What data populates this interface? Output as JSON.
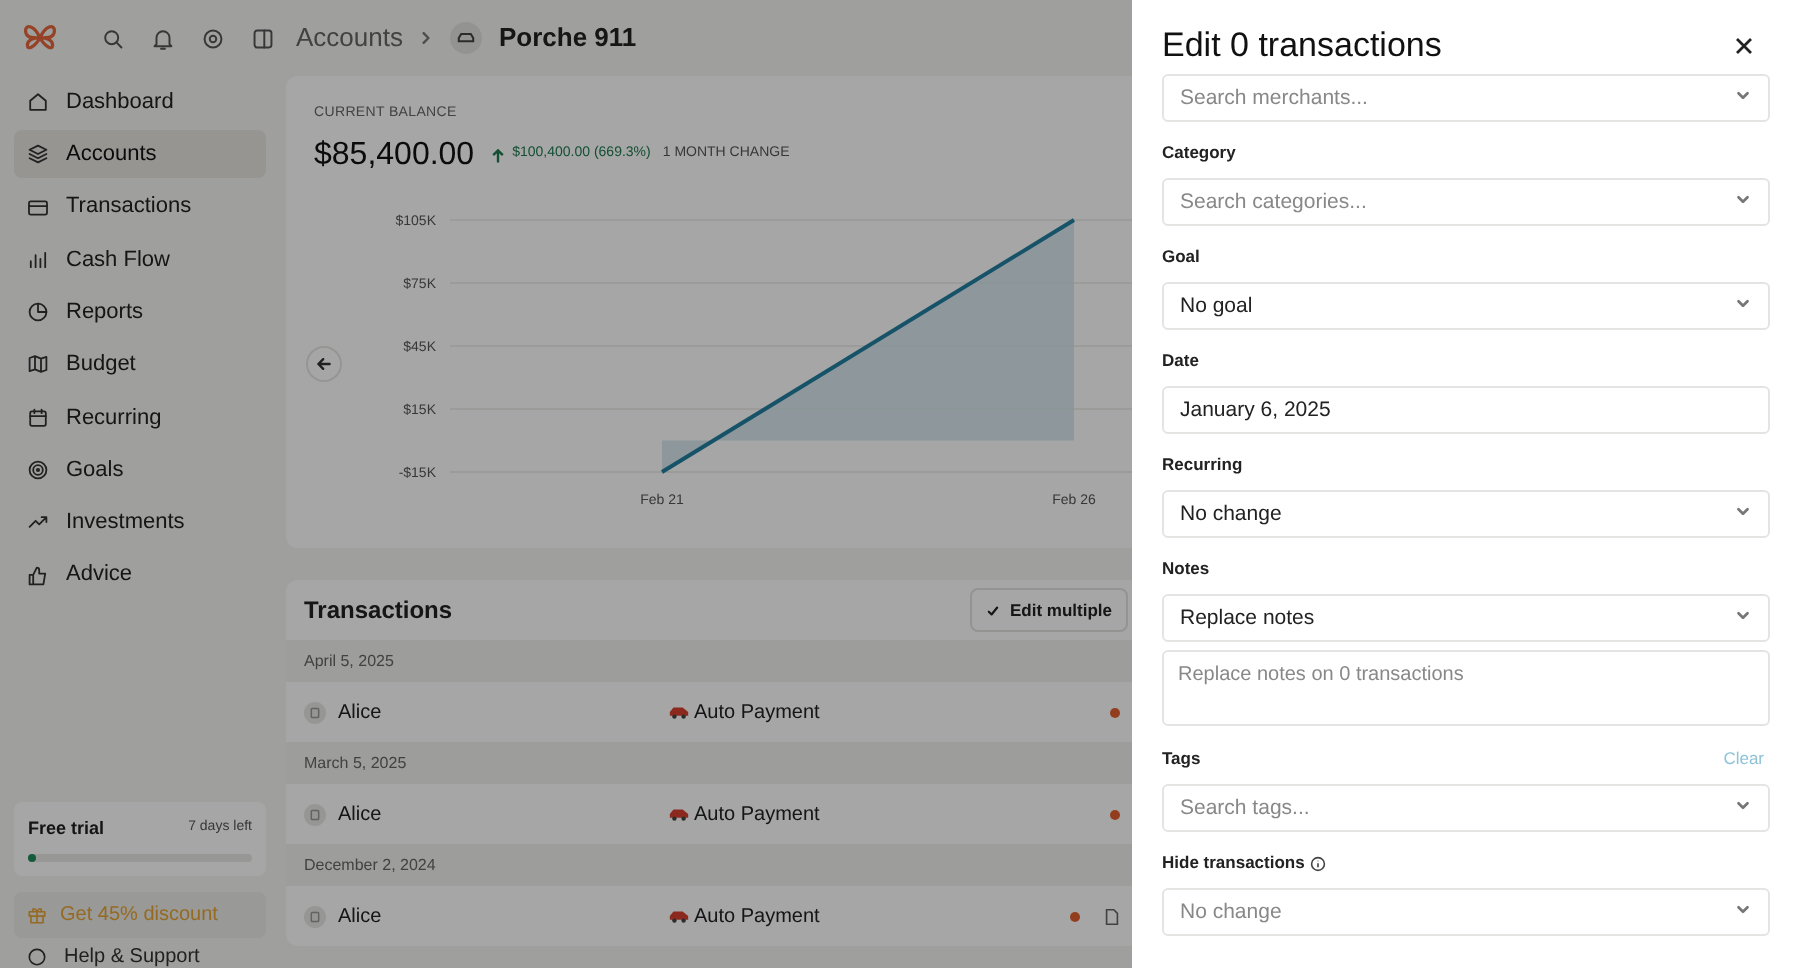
{
  "header": {
    "breadcrumb": [
      {
        "label": "Accounts",
        "kind": "link"
      },
      {
        "label": "Porche 911",
        "kind": "current"
      }
    ]
  },
  "sidebar": {
    "items": [
      {
        "label": "Dashboard",
        "selected": false
      },
      {
        "label": "Accounts",
        "selected": true
      },
      {
        "label": "Transactions",
        "selected": false
      },
      {
        "label": "Cash Flow",
        "selected": false
      },
      {
        "label": "Reports",
        "selected": false
      },
      {
        "label": "Budget",
        "selected": false
      },
      {
        "label": "Recurring",
        "selected": false
      },
      {
        "label": "Goals",
        "selected": false
      },
      {
        "label": "Investments",
        "selected": false
      },
      {
        "label": "Advice",
        "selected": false
      }
    ],
    "trial": {
      "title": "Free trial",
      "remaining": "7 days left",
      "level": 0.04
    },
    "discount_button": "Get 45% discount",
    "help": "Help & Support"
  },
  "balance_card": {
    "label": "CURRENT BALANCE",
    "amount": "$85,400.00",
    "change": "$100,400.00 (669.3%)",
    "period": "1 MONTH CHANGE",
    "chart_data": {
      "type": "area",
      "grid": true,
      "ylim": [
        -15000,
        105000
      ],
      "categories": [
        "Feb 21",
        "Feb 26"
      ],
      "values": [
        -15000,
        105000
      ],
      "yticks": [
        {
          "value": 105000,
          "label": "$105K"
        },
        {
          "value": 75000,
          "label": "$75K"
        },
        {
          "value": 45000,
          "label": "$45K"
        },
        {
          "value": 15000,
          "label": "$15K"
        },
        {
          "value": -15000,
          "label": "-$15K"
        }
      ]
    }
  },
  "transactions": {
    "title": "Transactions",
    "edit_button": "Edit multiple",
    "groups": [
      {
        "date": "April 5, 2025",
        "rows": [
          {
            "merchant": "Alice",
            "category": "Auto Payment",
            "unreviewed": true,
            "attachment": false
          }
        ]
      },
      {
        "date": "March 5, 2025",
        "rows": [
          {
            "merchant": "Alice",
            "category": "Auto Payment",
            "unreviewed": true,
            "attachment": false
          }
        ]
      },
      {
        "date": "December 2, 2024",
        "rows": [
          {
            "merchant": "Alice",
            "category": "Auto Payment",
            "unreviewed": true,
            "attachment": true
          }
        ]
      }
    ]
  },
  "edit_panel": {
    "title": "Edit 0 transactions",
    "groups": [
      {
        "controls": [
          {
            "kind": "select",
            "placeholder": "Search merchants..."
          }
        ]
      },
      {
        "label": "Category",
        "controls": [
          {
            "kind": "select",
            "placeholder": "Search categories..."
          }
        ]
      },
      {
        "label": "Goal",
        "controls": [
          {
            "kind": "select",
            "value": "No goal"
          }
        ]
      },
      {
        "label": "Date",
        "controls": [
          {
            "kind": "input",
            "value": "January 6, 2025"
          }
        ]
      },
      {
        "label": "Recurring",
        "controls": [
          {
            "kind": "select",
            "value": "No change"
          }
        ]
      },
      {
        "label": "Notes",
        "controls": [
          {
            "kind": "select",
            "value": "Replace notes"
          },
          {
            "kind": "textarea",
            "placeholder": "Replace notes on 0 transactions"
          }
        ]
      },
      {
        "label": "Tags",
        "action": "Clear",
        "controls": [
          {
            "kind": "select",
            "placeholder": "Search tags..."
          }
        ]
      },
      {
        "label": "Hide transactions",
        "info": true,
        "controls": [
          {
            "kind": "select",
            "placeholder": "No change"
          }
        ]
      }
    ]
  }
}
